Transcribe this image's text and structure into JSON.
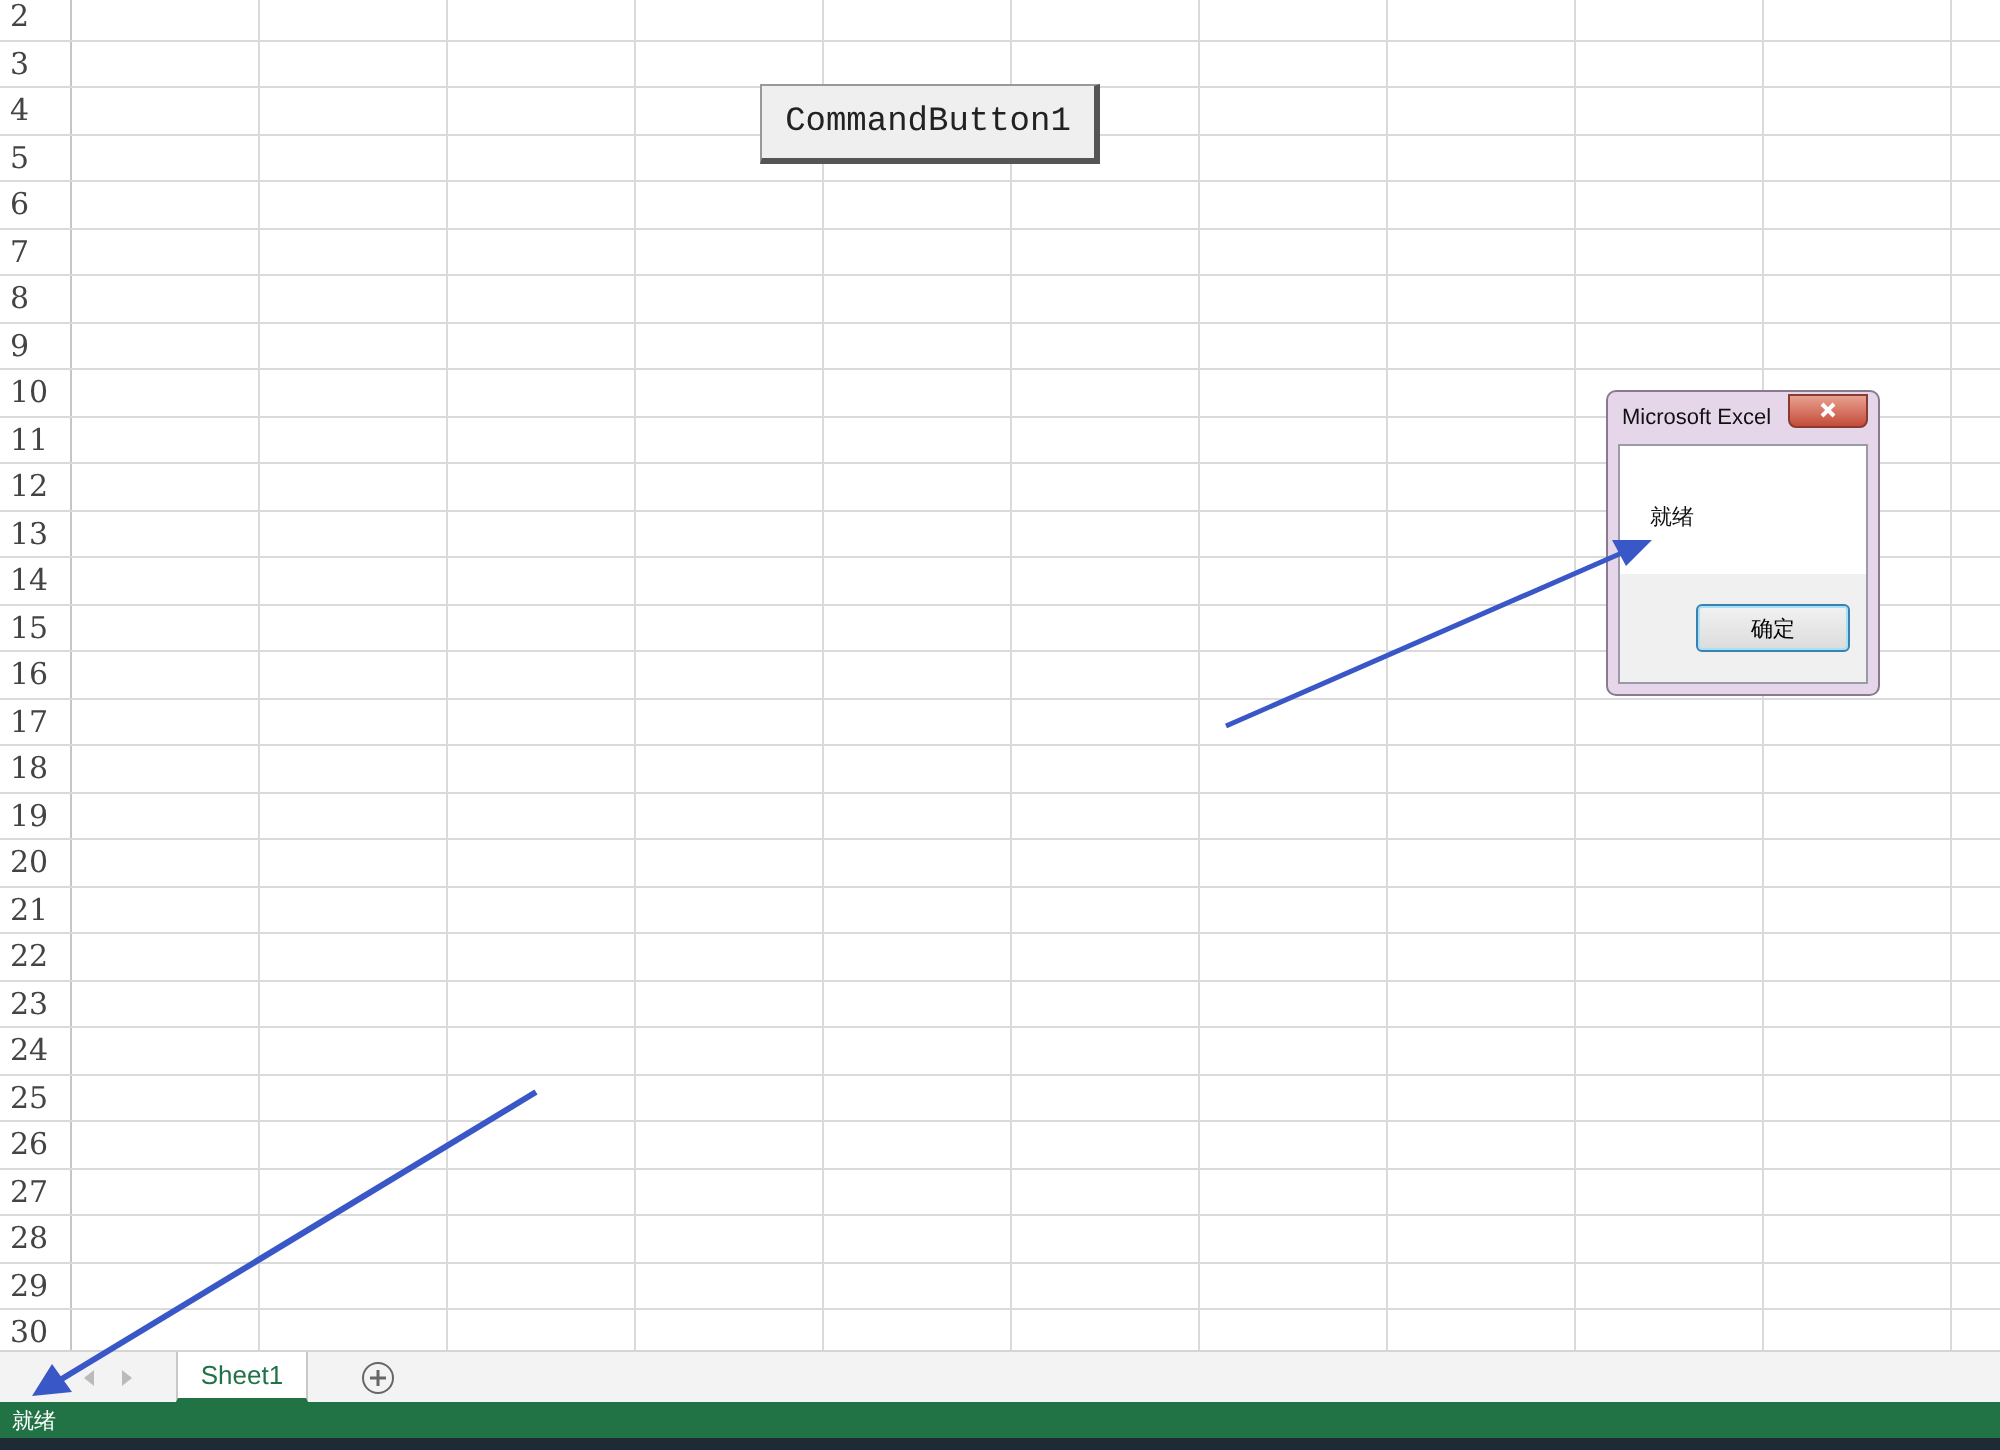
{
  "row_headers": [
    "2",
    "3",
    "4",
    "5",
    "6",
    "7",
    "8",
    "9",
    "10",
    "11",
    "12",
    "13",
    "14",
    "15",
    "16",
    "17",
    "18",
    "19",
    "20",
    "21",
    "22",
    "23",
    "24",
    "25",
    "26",
    "27",
    "28",
    "29",
    "30"
  ],
  "command_button": {
    "label": "CommandButton1"
  },
  "dialog": {
    "title": "Microsoft Excel",
    "message": "就绪",
    "ok_button": "确定"
  },
  "sheet_tabs": [
    {
      "label": "Sheet1",
      "selected": true
    }
  ],
  "status_bar": {
    "text": "就绪"
  }
}
